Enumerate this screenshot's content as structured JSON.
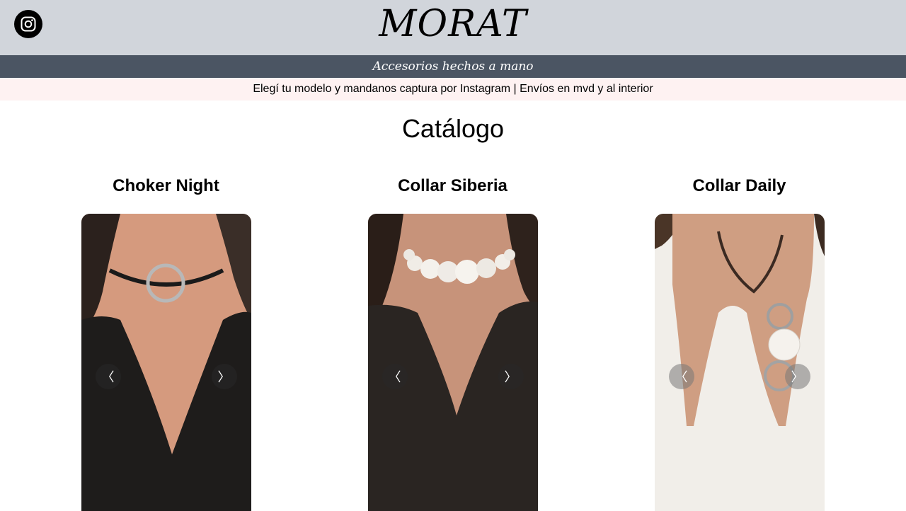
{
  "header": {
    "brand": "MORAT",
    "instagram_icon": "instagram-icon",
    "bg_color": "#d1d5db"
  },
  "tagline": {
    "text": "Accesorios hechos a mano",
    "bg_color": "#4b5563"
  },
  "notice": {
    "text": "Elegí tu modelo y mandanos captura por Instagram | Envíos en mvd y al interior",
    "bg_color": "#fef2f2"
  },
  "catalog": {
    "title": "Catálogo",
    "products": [
      {
        "name": "Choker Night",
        "prev_label": "〈",
        "next_label": "〉",
        "photo": "black choker with silver ring on black top"
      },
      {
        "name": "Collar Siberia",
        "prev_label": "〈",
        "next_label": "〉",
        "photo": "white mother-of-pearl disc choker on dark top"
      },
      {
        "name": "Collar Daily",
        "prev_label": "〈",
        "next_label": "〉",
        "photo": "leather cord necklace with silver rings and shell disc on white blouse"
      }
    ]
  }
}
